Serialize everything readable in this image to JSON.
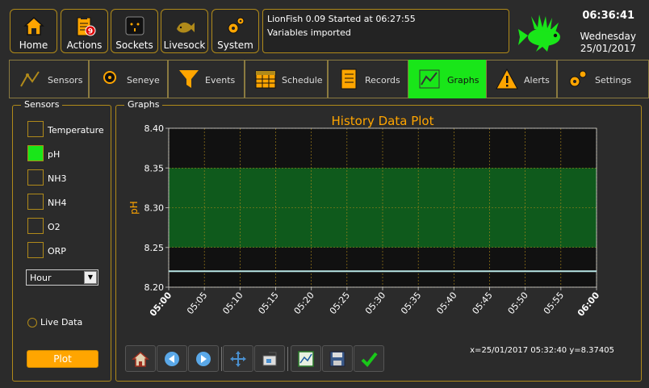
{
  "topbar": {
    "buttons": [
      {
        "label": "Home",
        "icon": "house-icon"
      },
      {
        "label": "Actions",
        "icon": "clipboard-icon",
        "badge": "9"
      },
      {
        "label": "Sockets",
        "icon": "socket-icon"
      },
      {
        "label": "Livesock",
        "icon": "livestock-icon"
      },
      {
        "label": "System",
        "icon": "gears-icon"
      }
    ],
    "status_lines": [
      "LionFish 0.09 Started at 06:27:55",
      "Variables imported"
    ],
    "clock": "06:36:41",
    "day": "Wednesday",
    "date": "25/01/2017"
  },
  "tabs": [
    {
      "label": "Sensors"
    },
    {
      "label": "Seneye"
    },
    {
      "label": "Events"
    },
    {
      "label": "Schedule"
    },
    {
      "label": "Records"
    },
    {
      "label": "Graphs",
      "active": true
    },
    {
      "label": "Alerts"
    },
    {
      "label": "Settings"
    }
  ],
  "sensors_panel": {
    "title": "Sensors",
    "items": [
      {
        "label": "Temperature",
        "checked": false
      },
      {
        "label": "pH",
        "checked": true
      },
      {
        "label": "NH3",
        "checked": false
      },
      {
        "label": "NH4",
        "checked": false
      },
      {
        "label": "O2",
        "checked": false
      },
      {
        "label": "ORP",
        "checked": false
      }
    ],
    "range_select": "Hour",
    "live_data_label": "Live Data",
    "plot_label": "Plot"
  },
  "graphs_panel": {
    "title": "Graphs",
    "coord_readout": "x=25/01/2017 05:32:40 y=8.37405",
    "toolbar": [
      "home-icon",
      "back-arrow-icon",
      "forward-arrow-icon",
      "pan-icon",
      "zoom-icon",
      "subplot-config-icon",
      "save-icon",
      "check-icon"
    ]
  },
  "colors": {
    "accent": "#ffa500",
    "active_green": "#19e619",
    "band_green": "#0f5a1c",
    "border_gold": "#b08a1a",
    "line_color": "#b8e6e6"
  },
  "chart_data": {
    "type": "line",
    "title": "History Data Plot",
    "xlabel": "",
    "ylabel": "pH",
    "x": [
      "05:00",
      "05:05",
      "05:10",
      "05:15",
      "05:20",
      "05:25",
      "05:30",
      "05:35",
      "05:40",
      "05:45",
      "05:50",
      "05:55",
      "06:00"
    ],
    "ylim": [
      8.2,
      8.4
    ],
    "yticks": [
      "8.20",
      "8.25",
      "8.30",
      "8.35",
      "8.40"
    ],
    "series": [
      {
        "values": [
          8.22,
          8.22,
          8.22,
          8.22,
          8.22,
          8.22,
          8.22,
          8.22,
          8.22,
          8.22,
          8.22,
          8.22,
          8.22
        ]
      }
    ],
    "band": [
      8.25,
      8.35
    ],
    "grid": true
  }
}
